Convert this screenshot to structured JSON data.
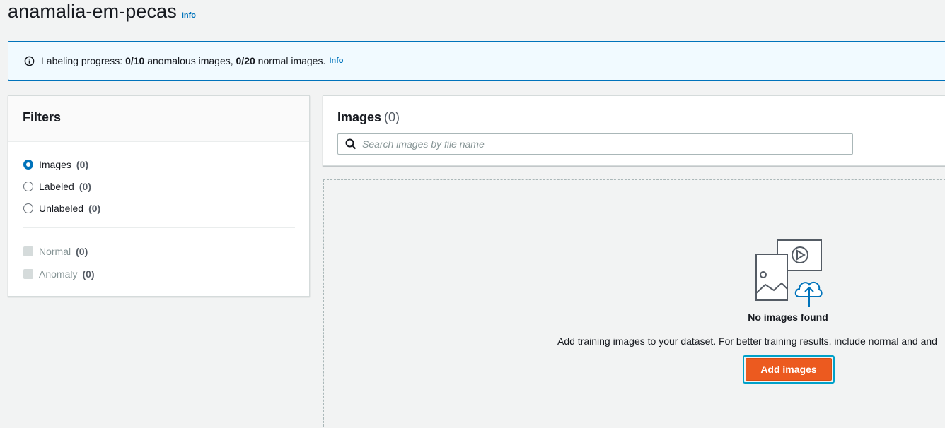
{
  "header": {
    "title": "anamalia-em-pecas",
    "info_label": "Info"
  },
  "flash": {
    "prefix": "Labeling progress:",
    "anomalous_count": "0/10",
    "anomalous_text": "anomalous images,",
    "normal_count": "0/20",
    "normal_text": "normal images.",
    "info_label": "Info"
  },
  "filters": {
    "title": "Filters",
    "radios": [
      {
        "label": "Images",
        "count": "(0)",
        "checked": true
      },
      {
        "label": "Labeled",
        "count": "(0)",
        "checked": false
      },
      {
        "label": "Unlabeled",
        "count": "(0)",
        "checked": false
      }
    ],
    "checkboxes": [
      {
        "label": "Normal",
        "count": "(0)"
      },
      {
        "label": "Anomaly",
        "count": "(0)"
      }
    ]
  },
  "images": {
    "title": "Images",
    "count": "(0)",
    "search_placeholder": "Search images by file name"
  },
  "empty": {
    "title": "No images found",
    "description": "Add training images to your dataset. For better training results, include normal and and",
    "button_label": "Add images"
  },
  "colors": {
    "accent": "#0073bb",
    "primary_button": "#ec5a1f",
    "focus_ring": "#00a1c9",
    "background": "#f2f3f3"
  }
}
